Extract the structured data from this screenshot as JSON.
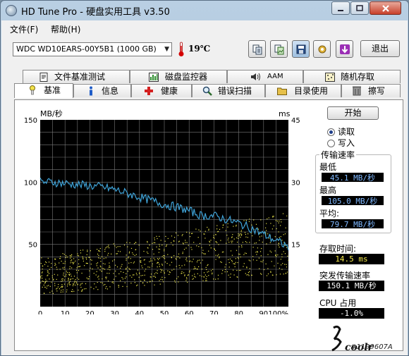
{
  "window": {
    "title": "HD Tune Pro - 硬盘实用工具 v3.50"
  },
  "menu": [
    "文件(F)",
    "帮助(H)"
  ],
  "toolbar": {
    "drive": "WDC WD10EARS-00Y5B1 (1000 GB)",
    "temperature": "19℃",
    "exit_label": "退出",
    "buttons": [
      "copy-text-icon",
      "copy-screenshot-icon",
      "save-icon",
      "options-icon",
      "download-icon"
    ]
  },
  "tabs_top": [
    {
      "label": "文件基准测试",
      "icon": "file-benchmark-icon"
    },
    {
      "label": "磁盘监控器",
      "icon": "disk-monitor-icon"
    },
    {
      "label": "AAM",
      "icon": "speaker-icon"
    },
    {
      "label": "随机存取",
      "icon": "random-access-icon"
    }
  ],
  "tabs_bottom": [
    {
      "label": "基准",
      "icon": "benchmark-icon",
      "active": true
    },
    {
      "label": "信息",
      "icon": "info-icon"
    },
    {
      "label": "健康",
      "icon": "health-icon"
    },
    {
      "label": "错误扫描",
      "icon": "error-scan-icon"
    },
    {
      "label": "目录使用",
      "icon": "folder-icon"
    },
    {
      "label": "擦写",
      "icon": "erase-icon"
    }
  ],
  "controls": {
    "start_label": "开始",
    "read_label": "读取",
    "write_label": "写入",
    "selected": "read"
  },
  "stats": {
    "group_title": "传输速率",
    "min_label": "最低",
    "min_value": "45.1 MB/秒",
    "max_label": "最高",
    "max_value": "105.0 MB/秒",
    "avg_label": "平均:",
    "avg_value": "79.7 MB/秒",
    "access_label": "存取时间:",
    "access_value": "14.5 ms",
    "burst_label": "突发传输速率",
    "burst_value": "150.1 MB/秒",
    "cpu_label": "CPU 占用",
    "cpu_value": "-1.0%"
  },
  "watermark": {
    "text": "coolr",
    "id": "#1199607A"
  },
  "chart_data": {
    "type": "line",
    "ylabel": "MB/秒",
    "y2label": "ms",
    "ylim": [
      0,
      150
    ],
    "y2lim": [
      0,
      45
    ],
    "yticks": [
      50,
      100,
      150
    ],
    "y2ticks": [
      15,
      30,
      45
    ],
    "xticks": [
      "0",
      "10",
      "20",
      "30",
      "40",
      "50",
      "60",
      "70",
      "80",
      "90",
      "100%"
    ],
    "xlim": [
      0,
      100
    ],
    "colors": {
      "transfer": "#3fa3d8",
      "access": "#e8e24a",
      "background": "#000000",
      "grid": "#7a7a7a"
    },
    "series": [
      {
        "name": "传输速率",
        "axis": "left",
        "x": [
          0,
          5,
          10,
          15,
          20,
          25,
          30,
          35,
          40,
          45,
          50,
          55,
          60,
          65,
          70,
          75,
          80,
          85,
          90,
          95,
          100
        ],
        "values": [
          100,
          100,
          99,
          98,
          97,
          96,
          94,
          91,
          88,
          85,
          82,
          80,
          77,
          73,
          73,
          70,
          67,
          63,
          58,
          53,
          48
        ]
      },
      {
        "name": "存取时间",
        "axis": "right",
        "type": "scatter",
        "x_range": [
          0,
          100
        ],
        "y_range": [
          3,
          25
        ],
        "description_count": 900
      }
    ]
  }
}
